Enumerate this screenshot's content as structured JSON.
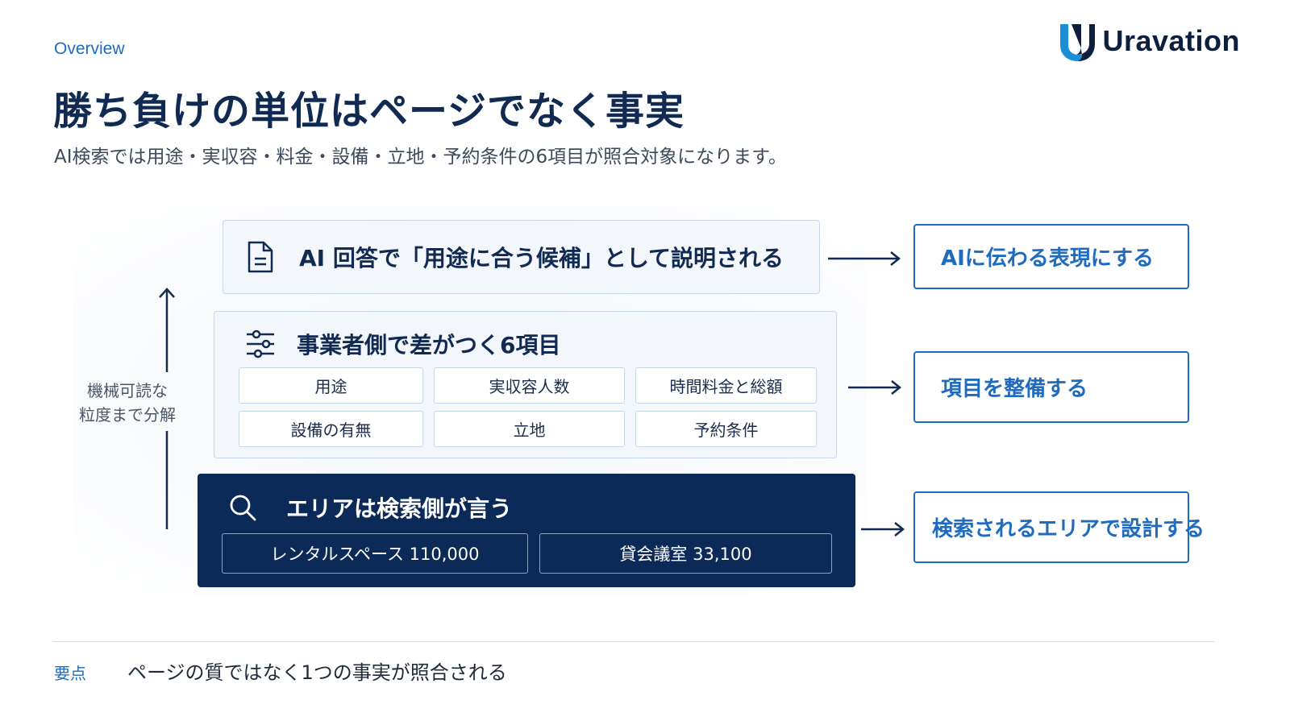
{
  "header": {
    "eyebrow": "Overview",
    "title": "勝ち負けの単位はページでなく事実",
    "subtitle": "AI検索では用途・実収容・料金・設備・立地・予約条件の6項目が照合対象になります。",
    "logo_text": "Uravation"
  },
  "diagram": {
    "axis_label_line1": "機械可読な",
    "axis_label_line2": "粒度まで分解",
    "top_layer": {
      "label": "AI 回答で「用途に合う候補」として説明される",
      "icon": "document-icon"
    },
    "mid_layer": {
      "label": "事業者側で差がつく6項目",
      "icon": "sliders-icon",
      "items": [
        "用途",
        "実収容人数",
        "時間料金と総額",
        "設備の有無",
        "立地",
        "予約条件"
      ]
    },
    "bottom_layer": {
      "label": "エリアは検索側が言う",
      "icon": "search-icon",
      "keywords": [
        "レンタルスペース 110,000",
        "貸会議室 33,100"
      ]
    },
    "outcomes": [
      "AIに伝わる表現にする",
      "項目を整備する",
      "検索されるエリアで設計する"
    ]
  },
  "footer": {
    "key_label": "要点",
    "key_text": "ページの質ではなく1つの事実が照合される"
  },
  "colors": {
    "navy": "#0c2a57",
    "accent_blue": "#1f6bbf",
    "light_panel": "#f3f6fa",
    "panel_border": "#c9d8e8"
  }
}
